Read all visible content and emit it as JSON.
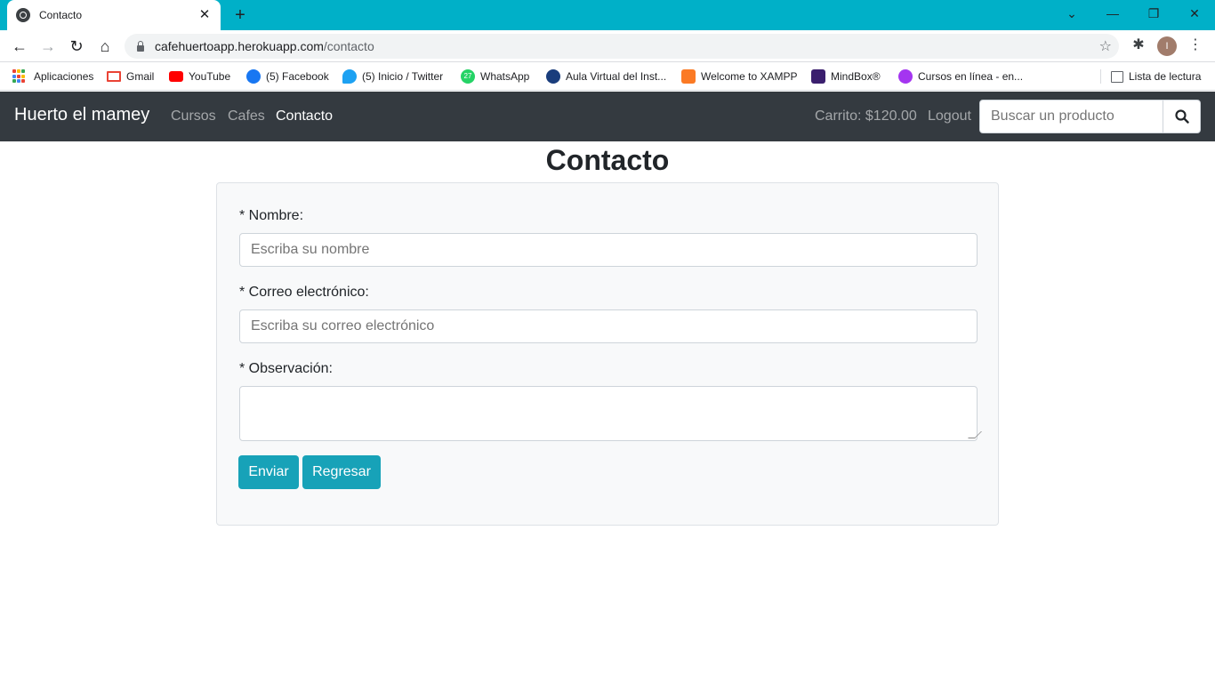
{
  "browser": {
    "tab_title": "Contacto",
    "tab_close": "✕",
    "new_tab": "+",
    "url_host": "cafehuertoapp.herokuapp.com",
    "url_path": "/contacto",
    "profile_initial": "I",
    "window_controls": {
      "minimize": "—",
      "maximize": "❐",
      "close": "✕"
    },
    "nav": {
      "back": "←",
      "forward": "→",
      "reload": "↻",
      "home": "⌂"
    },
    "bookmarks": [
      {
        "label": "Aplicaciones",
        "icon": "apps-icon",
        "color": "#ea4335"
      },
      {
        "label": "Gmail",
        "icon": "gmail-icon",
        "color": "#ea4335"
      },
      {
        "label": "YouTube",
        "icon": "youtube-icon",
        "color": "#ff0000"
      },
      {
        "label": "(5) Facebook",
        "icon": "facebook-icon",
        "color": "#1877f2"
      },
      {
        "label": "(5) Inicio / Twitter",
        "icon": "twitter-icon",
        "color": "#1da1f2"
      },
      {
        "label": "WhatsApp",
        "icon": "whatsapp-icon",
        "color": "#25d366",
        "badge": "27"
      },
      {
        "label": "Aula Virtual del Inst...",
        "icon": "aula-icon",
        "color": "#1a3d7c"
      },
      {
        "label": "Welcome to XAMPP",
        "icon": "xampp-icon",
        "color": "#fb7a24"
      },
      {
        "label": "MindBox®",
        "icon": "mindbox-icon",
        "color": "#3b1f6e"
      },
      {
        "label": "Cursos en línea - en...",
        "icon": "udemy-icon",
        "color": "#a435f0"
      }
    ],
    "reading_list": "Lista de lectura"
  },
  "navbar": {
    "brand": "Huerto el mamey",
    "links": [
      "Cursos",
      "Cafes",
      "Contacto"
    ],
    "active_link": "Contacto",
    "cart": "Carrito: $120.00",
    "logout": "Logout",
    "search_placeholder": "Buscar un producto"
  },
  "page": {
    "title": "Contacto",
    "form": {
      "name_label": "* Nombre:",
      "name_placeholder": "Escriba su nombre",
      "email_label": "* Correo electrónico:",
      "email_placeholder": "Escriba su correo electrónico",
      "observation_label": "* Observación:",
      "submit": "Enviar",
      "back": "Regresar"
    }
  },
  "colors": {
    "titlebar": "#00b0c8",
    "navbar": "#343a40",
    "button": "#17a2b8"
  }
}
